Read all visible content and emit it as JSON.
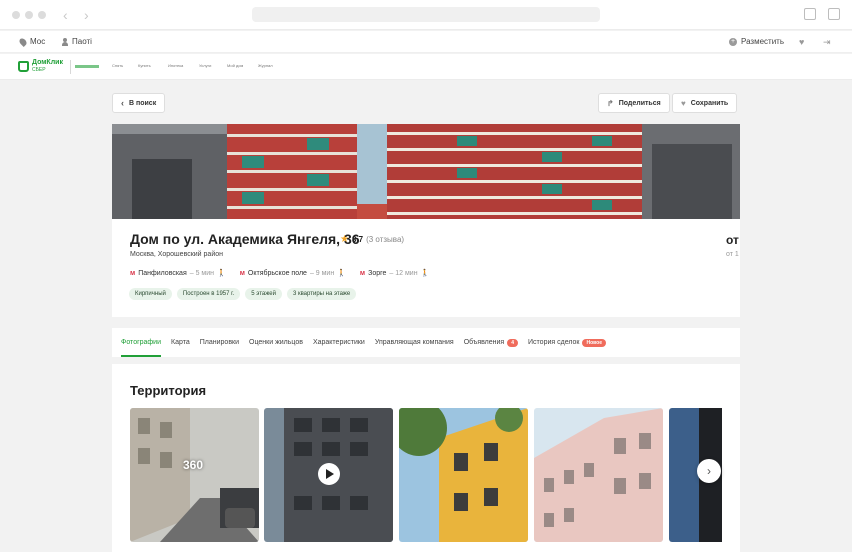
{
  "topbar": {
    "city": "Мос",
    "login": "Паоті",
    "place_ad": "Разместить"
  },
  "logo": {
    "name": "ДомКлик",
    "sub": "СБЕР"
  },
  "menu": [
    "Снять",
    "Купить",
    "Ипотека",
    "Услуги",
    "Мой дом",
    "Журнал"
  ],
  "nav": {
    "back": "В поиск",
    "share": "Поделиться",
    "save": "Сохранить"
  },
  "house": {
    "title": "Дом по ул. Академика Янгеля, 36",
    "rating": "3.7",
    "reviews": "(3 отзыва)",
    "address": "Москва, Хорошевский район",
    "metros": [
      {
        "name": "Панфиловская",
        "time": "– 5 мин"
      },
      {
        "name": "Октябрьское поле",
        "time": "– 9 мин"
      },
      {
        "name": "Зорге",
        "time": "– 12 мин"
      }
    ],
    "tags": [
      "Кирпичный",
      "Построен в 1957 г.",
      "5 этажей",
      "3 квартиры на этаже"
    ],
    "price_cut": "от",
    "price_sub": "от 1"
  },
  "tabs": [
    {
      "label": "Фотографии"
    },
    {
      "label": "Карта"
    },
    {
      "label": "Планировки"
    },
    {
      "label": "Оценки жильцов"
    },
    {
      "label": "Характеристики"
    },
    {
      "label": "Управляющая компания"
    },
    {
      "label": "Объявления",
      "badge": "4"
    },
    {
      "label": "История сделок",
      "badge": "Новое"
    }
  ],
  "gallery": {
    "title": "Территория",
    "label_360": "360"
  },
  "colors": {
    "accent": "#21a038",
    "badge": "#f06c5c",
    "metro": "#d9374b"
  }
}
